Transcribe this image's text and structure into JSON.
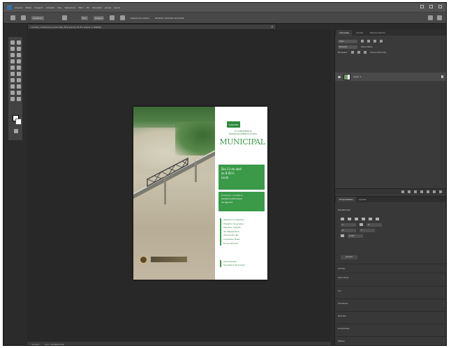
{
  "app": {
    "menu": [
      "Arquivo",
      "Editar",
      "Imagem",
      "Camada",
      "Tipo",
      "Selecionar",
      "Filtro",
      "3D",
      "Visualizar",
      "Janela",
      "Ajuda"
    ]
  },
  "options_bar": {
    "tool_preset": "Contorno",
    "field_a": "Fixo",
    "field_b": "Largura",
    "label_auto": "Selecionar autom.",
    "label_transform": "Mostrar controles de transf."
  },
  "document_tab": {
    "title": "convite_conferencia_municipal_final.psd @ 33,3% (Layer 1, RGB/8)"
  },
  "flyer": {
    "badge": "CONVITE",
    "subtitle_1": "1ª CONFERÊNCIA",
    "subtitle_2": "DESENVOLVIMENTO RURAL",
    "title": "MUNICIPAL",
    "date_line_1": "Dia 23 de abril",
    "date_line_2": "às 8:00 h",
    "date_line_3": "Local",
    "place_label": "Endereço / Auditório",
    "place_line_1": "Prefeitura Municipal",
    "place_line_2": "de Jaguaré",
    "program": [
      "Abertura e palestra",
      "Trabalho de grupos",
      "Plenária, eleição",
      "de delegados e",
      "aprovação das",
      "propostas finais",
      "Encerramento"
    ],
    "contact": [
      "Informações:",
      "Secretaria Municipal"
    ],
    "seal_text": "PREFEITURA DE JAGUARÉ"
  },
  "status_bar": {
    "zoom": "33,33%",
    "info": "Doc: 25,8M/51,6M"
  },
  "layers_panel": {
    "tabs": [
      "Camadas",
      "Canais",
      "Demarcadores"
    ],
    "kind_label": "Tipo",
    "blend_mode": "Normal",
    "opacity_label": "Opacidade:",
    "lock_label": "Bloquear:",
    "fill_label": "Preenchimento:",
    "layer_name": "Layer 1"
  },
  "properties_panel": {
    "tabs": [
      "Propriedades",
      "Ajustes"
    ],
    "section": "Transformar",
    "fields": [
      "L:",
      "A:",
      "X:",
      "Y:",
      "0,00°"
    ],
    "button": "Limpar",
    "collapsed_sections": [
      "Alinhar",
      "Sem título",
      "Cor",
      "Amostras",
      "Padrões",
      "Gradientes",
      "Estilos"
    ]
  },
  "colors": {
    "accent_green": "#3a9a48",
    "panel_bg": "#3a3a3a",
    "canvas_bg": "#282828"
  }
}
